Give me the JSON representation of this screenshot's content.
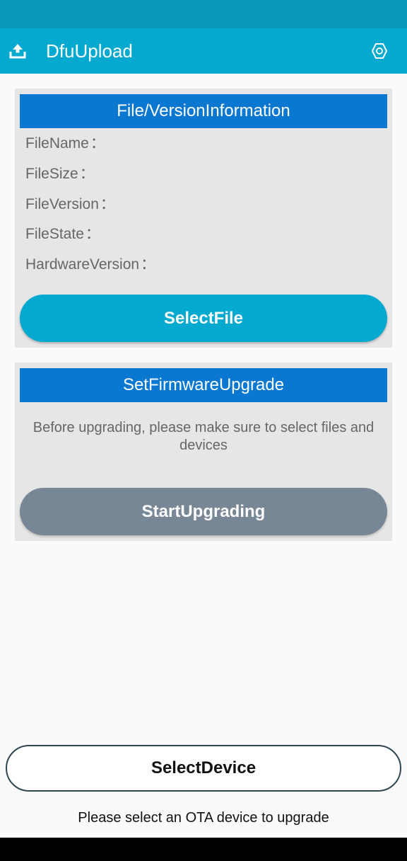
{
  "app": {
    "title": "DfuUpload",
    "icons": {
      "left": "upload-icon",
      "right": "settings-icon"
    },
    "colors": {
      "status_bar": "#0899ba",
      "app_bar": "#03a9cf",
      "card_header": "#0a78d0",
      "select_file_button": "#03a9cf",
      "start_button": "#788796"
    }
  },
  "file_card": {
    "header": "File/VersionInformation",
    "fields": [
      {
        "label": "FileName",
        "value": ""
      },
      {
        "label": "FileSize",
        "value": ""
      },
      {
        "label": "FileVersion",
        "value": ""
      },
      {
        "label": "FileState",
        "value": ""
      },
      {
        "label": "HardwareVersion",
        "value": ""
      }
    ],
    "colon": "：",
    "select_file_label": "SelectFile"
  },
  "upgrade_card": {
    "header": "SetFirmwareUpgrade",
    "hint": "Before upgrading, please make sure to select files and devices",
    "start_label": "StartUpgrading"
  },
  "bottom": {
    "select_device_label": "SelectDevice",
    "status_text": "Please select an OTA device to upgrade"
  }
}
